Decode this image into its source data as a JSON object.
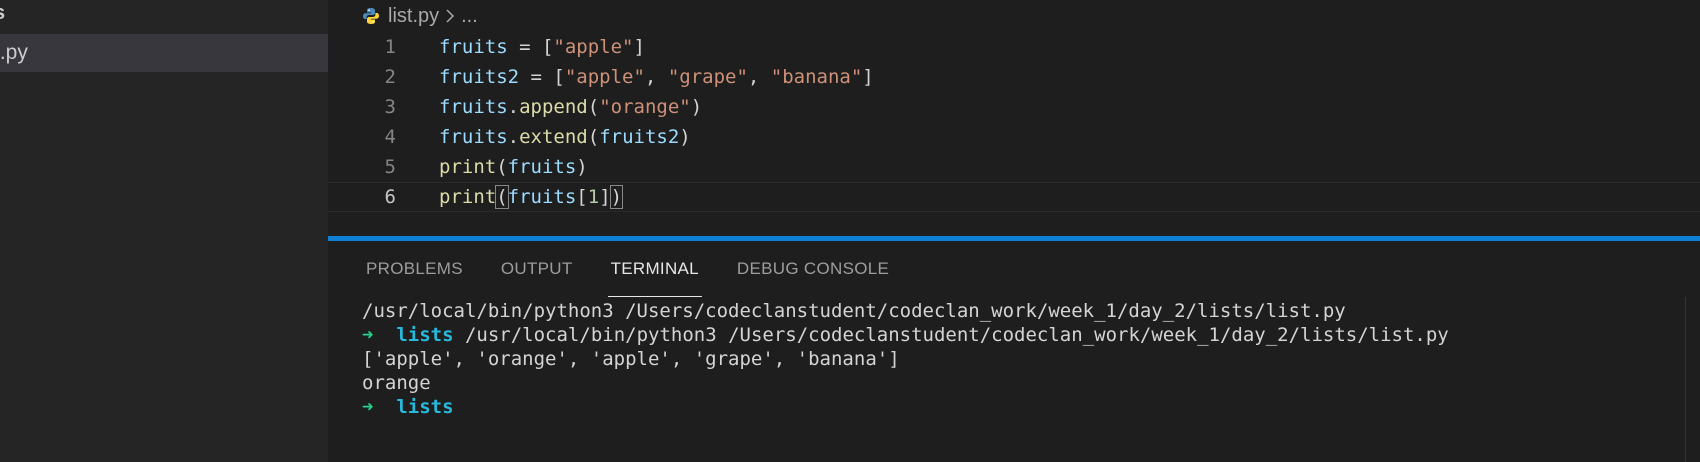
{
  "sidebar": {
    "header": "s",
    "file_label": "t.py"
  },
  "breadcrumb": {
    "file": "list.py",
    "more": "..."
  },
  "code": {
    "lines": [
      {
        "number": "1"
      },
      {
        "number": "2"
      },
      {
        "number": "3"
      },
      {
        "number": "4"
      },
      {
        "number": "5"
      },
      {
        "number": "6"
      }
    ],
    "tokens": {
      "l1": [
        "fruits",
        " = [",
        "\"apple\"",
        "]"
      ],
      "l2": [
        "fruits2",
        " = [",
        "\"apple\"",
        ", ",
        "\"grape\"",
        ", ",
        "\"banana\"",
        "]"
      ],
      "l3": [
        "fruits",
        ".",
        "append",
        "(",
        "\"orange\"",
        ")"
      ],
      "l4": [
        "fruits",
        ".",
        "extend",
        "(",
        "fruits2",
        ")"
      ],
      "l5": [
        "print",
        "(",
        "fruits",
        ")"
      ],
      "l6": [
        "print",
        "(",
        "fruits",
        "[",
        "1",
        "]",
        ")"
      ]
    }
  },
  "panel": {
    "tabs": [
      "PROBLEMS",
      "OUTPUT",
      "TERMINAL",
      "DEBUG CONSOLE"
    ],
    "active_tab": "TERMINAL"
  },
  "terminal": {
    "line1": "/usr/local/bin/python3 /Users/codeclanstudent/codeclan_work/week_1/day_2/lists/list.py",
    "prompt_arrow": "➜",
    "prompt_dir": "lists",
    "line2_cmd": " /usr/local/bin/python3 /Users/codeclanstudent/codeclan_work/week_1/day_2/lists/list.py",
    "line3": "['apple', 'orange', 'apple', 'grape', 'banana']",
    "line4": "orange"
  },
  "colors": {
    "accent": "#0e7fd3",
    "string": "#ce9178",
    "variable": "#9cdcfe",
    "function": "#dcdcaa",
    "prompt_arrow": "#23d18b",
    "prompt_dir": "#29b8db"
  },
  "icons": {
    "python_file": "python-icon",
    "breadcrumb_separator": "chevron-right-icon"
  }
}
